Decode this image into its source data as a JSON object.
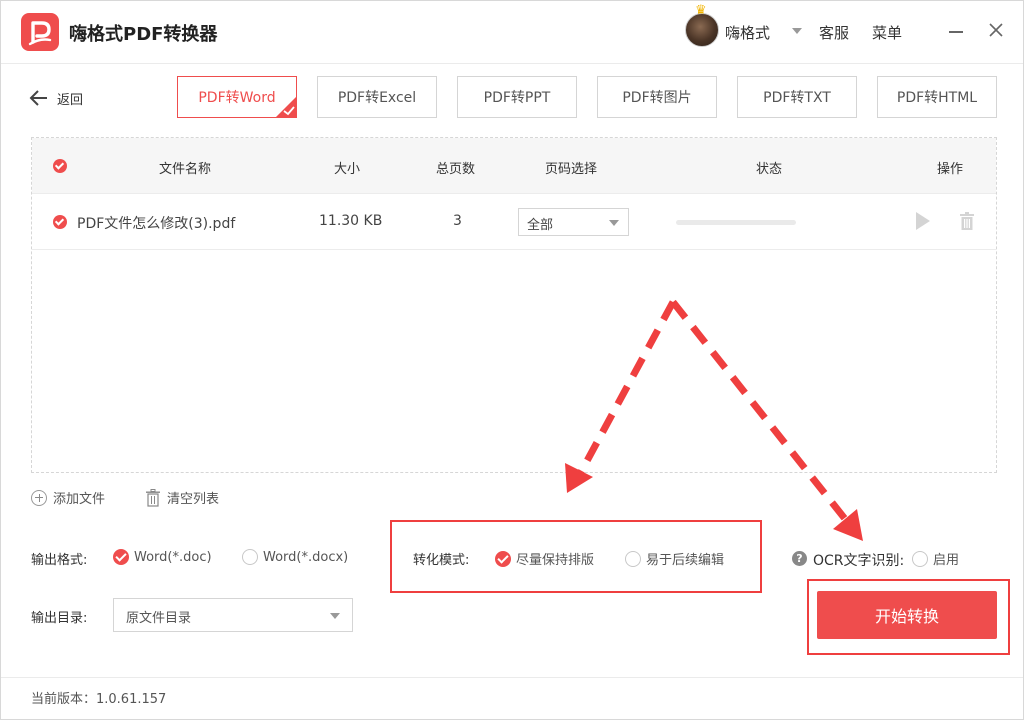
{
  "window": {
    "title": "嗨格式PDF转换器",
    "username": "嗨格式",
    "service": "客服",
    "menu": "菜单"
  },
  "nav": {
    "back_label": "返回",
    "tabs": [
      {
        "label": "PDF转Word",
        "active": true
      },
      {
        "label": "PDF转Excel",
        "active": false
      },
      {
        "label": "PDF转PPT",
        "active": false
      },
      {
        "label": "PDF转图片",
        "active": false
      },
      {
        "label": "PDF转TXT",
        "active": false
      },
      {
        "label": "PDF转HTML",
        "active": false
      }
    ]
  },
  "table": {
    "headers": {
      "name": "文件名称",
      "size": "大小",
      "pages": "总页数",
      "page_select": "页码选择",
      "status": "状态",
      "actions": "操作"
    },
    "rows": [
      {
        "name": "PDF文件怎么修改(3).pdf",
        "size": "11.30 KB",
        "pages": "3",
        "page_select": "全部",
        "progress": 0
      }
    ]
  },
  "actions": {
    "add_file": "添加文件",
    "clear_list": "清空列表"
  },
  "output": {
    "format_label": "输出格式:",
    "format_options": [
      "Word(*.doc)",
      "Word(*.docx)"
    ],
    "format_selected": "Word(*.doc)",
    "dir_label": "输出目录:",
    "dir_value": "原文件目录"
  },
  "mode": {
    "label": "转化模式:",
    "options": [
      "尽量保持排版",
      "易于后续编辑"
    ],
    "selected": "尽量保持排版"
  },
  "ocr": {
    "label": "OCR文字识别:",
    "option": "启用",
    "enabled": false
  },
  "start_button": "开始转换",
  "footer": {
    "version": "当前版本：1.0.61.157"
  },
  "colors": {
    "accent": "#ef4d4d",
    "annotation": "#ef3f3f"
  }
}
